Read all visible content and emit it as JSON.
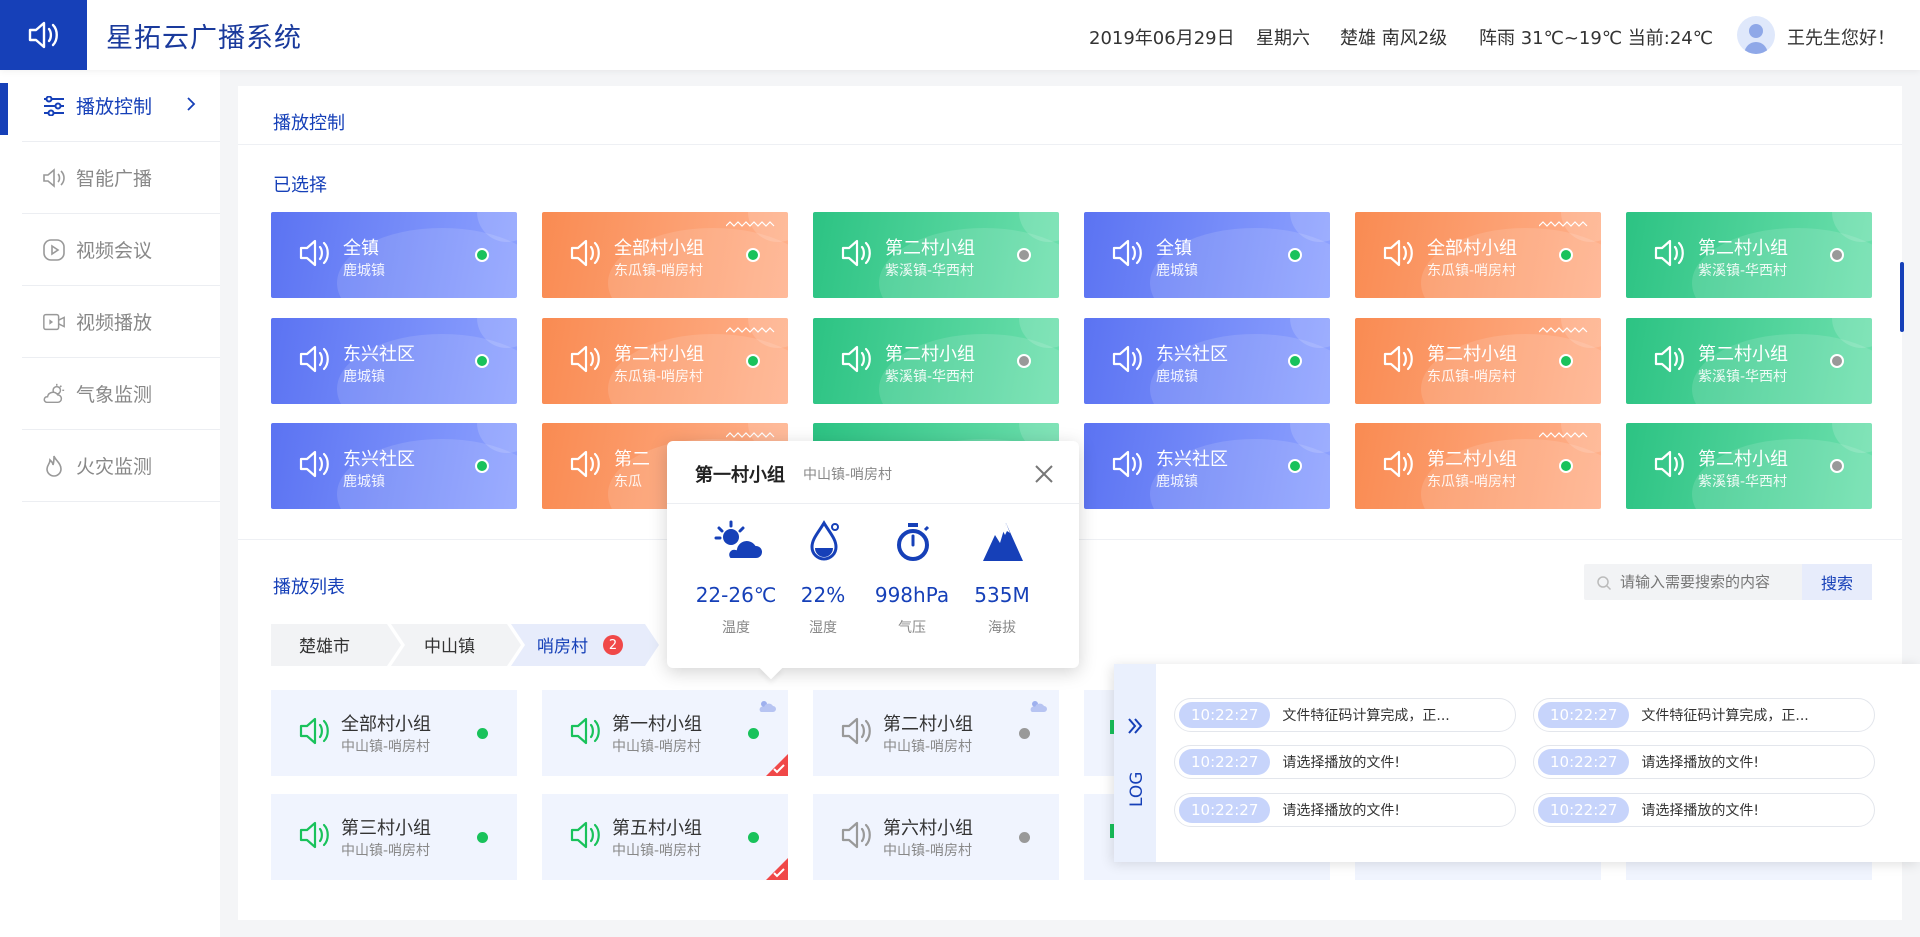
{
  "header": {
    "app_title": "星拓云广播系统",
    "date": "2019年06月29日",
    "weekday": "星期六",
    "location_wind": "楚雄 南风2级",
    "weather": "阵雨 31℃~19℃ 当前:24℃",
    "greeting": "王先生您好！"
  },
  "sidebar": {
    "items": [
      {
        "label": "播放控制",
        "icon": "sliders-icon",
        "active": true
      },
      {
        "label": "智能广播",
        "icon": "speaker-icon"
      },
      {
        "label": "视频会议",
        "icon": "play-circle-icon"
      },
      {
        "label": "视频播放",
        "icon": "video-icon"
      },
      {
        "label": "气象监测",
        "icon": "weather-icon"
      },
      {
        "label": "火灾监测",
        "icon": "fire-icon"
      }
    ]
  },
  "main": {
    "title": "播放控制",
    "selected_title": "已选择",
    "list_title": "播放列表",
    "selected": [
      {
        "name": "全镇",
        "sub": "鹿城镇",
        "color": "blue",
        "status": "online"
      },
      {
        "name": "全部村小组",
        "sub": "东瓜镇-哨房村",
        "color": "orange",
        "status": "online"
      },
      {
        "name": "第二村小组",
        "sub": "紫溪镇-华西村",
        "color": "green",
        "status": "offline"
      },
      {
        "name": "全镇",
        "sub": "鹿城镇",
        "color": "blue",
        "status": "online"
      },
      {
        "name": "全部村小组",
        "sub": "东瓜镇-哨房村",
        "color": "orange",
        "status": "online"
      },
      {
        "name": "第二村小组",
        "sub": "紫溪镇-华西村",
        "color": "green",
        "status": "offline"
      },
      {
        "name": "东兴社区",
        "sub": "鹿城镇",
        "color": "blue",
        "status": "online"
      },
      {
        "name": "第二村小组",
        "sub": "东瓜镇-哨房村",
        "color": "orange",
        "status": "online"
      },
      {
        "name": "第二村小组",
        "sub": "紫溪镇-华西村",
        "color": "green",
        "status": "offline"
      },
      {
        "name": "东兴社区",
        "sub": "鹿城镇",
        "color": "blue",
        "status": "online"
      },
      {
        "name": "第二村小组",
        "sub": "东瓜镇-哨房村",
        "color": "orange",
        "status": "online"
      },
      {
        "name": "第二村小组",
        "sub": "紫溪镇-华西村",
        "color": "green",
        "status": "offline"
      },
      {
        "name": "东兴社区",
        "sub": "鹿城镇",
        "color": "blue",
        "status": "online"
      },
      {
        "name": "第二",
        "sub": "东瓜",
        "color": "orange",
        "status": "online"
      },
      {
        "name": "",
        "sub": "",
        "color": "green",
        "status": "hidden"
      },
      {
        "name": "东兴社区",
        "sub": "鹿城镇",
        "color": "blue",
        "status": "online"
      },
      {
        "name": "第二村小组",
        "sub": "东瓜镇-哨房村",
        "color": "orange",
        "status": "online"
      },
      {
        "name": "第二村小组",
        "sub": "紫溪镇-华西村",
        "color": "green",
        "status": "offline"
      }
    ],
    "breadcrumb": [
      {
        "label": "楚雄市"
      },
      {
        "label": "中山镇"
      },
      {
        "label": "哨房村",
        "badge": "2"
      }
    ],
    "search": {
      "placeholder": "请输入需要搜索的内容",
      "button": "搜索"
    },
    "playlist": [
      {
        "name": "全部村小组",
        "sub": "中山镇-哨房村",
        "status": "online",
        "weather": false,
        "checked": false
      },
      {
        "name": "第一村小组",
        "sub": "中山镇-哨房村",
        "status": "online",
        "weather": true,
        "checked": true
      },
      {
        "name": "第二村小组",
        "sub": "中山镇-哨房村",
        "status": "offline",
        "weather": true,
        "checked": false
      },
      {
        "name": "第三村小组",
        "sub": "中山镇-哨房村",
        "status": "online",
        "weather": false,
        "checked": false
      },
      {
        "name": "第五村小组",
        "sub": "中山镇-哨房村",
        "status": "online",
        "weather": false,
        "checked": true
      },
      {
        "name": "第六村小组",
        "sub": "中山镇-哨房村",
        "status": "offline",
        "weather": false,
        "checked": false
      }
    ]
  },
  "popup": {
    "title": "第一村小组",
    "subtitle": "中山镇-哨房村",
    "metrics": [
      {
        "value": "22-26℃",
        "label": "温度",
        "icon": "partly-cloudy-icon"
      },
      {
        "value": "22%",
        "label": "湿度",
        "icon": "humidity-icon"
      },
      {
        "value": "998hPa",
        "label": "气压",
        "icon": "stopwatch-icon"
      },
      {
        "value": "535M",
        "label": "海拔",
        "icon": "mountain-icon"
      }
    ]
  },
  "log": {
    "label": "LOG",
    "entries": [
      {
        "time": "10:22:27",
        "msg": "文件特征码计算完成，正..."
      },
      {
        "time": "10:22:27",
        "msg": "文件特征码计算完成，正..."
      },
      {
        "time": "10:22:27",
        "msg": "请选择播放的文件!"
      },
      {
        "time": "10:22:27",
        "msg": "请选择播放的文件!"
      },
      {
        "time": "10:22:27",
        "msg": "请选择播放的文件!"
      },
      {
        "time": "10:22:27",
        "msg": "请选择播放的文件!"
      }
    ]
  },
  "colors": {
    "brand": "#1640b8",
    "online": "#19c25b",
    "offline": "#999999",
    "badge": "#f04848",
    "check": "#f04848"
  }
}
